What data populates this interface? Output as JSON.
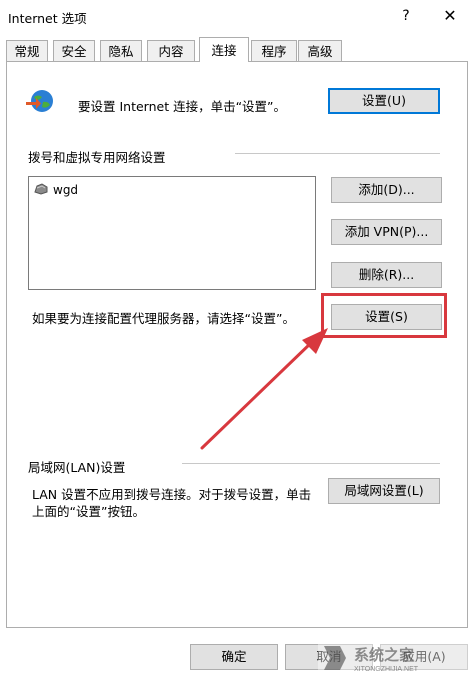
{
  "window": {
    "title": "Internet 选项",
    "help_label": "?",
    "close_label": "✕"
  },
  "tabs": [
    {
      "label": "常规"
    },
    {
      "label": "安全"
    },
    {
      "label": "隐私"
    },
    {
      "label": "内容"
    },
    {
      "label": "连接",
      "active": true
    },
    {
      "label": "程序"
    },
    {
      "label": "高级"
    }
  ],
  "setup": {
    "text": "要设置 Internet 连接，单击“设置”。",
    "button": "设置(U)"
  },
  "dialup": {
    "section_title": "拨号和虚拟专用网络设置",
    "items": [
      {
        "name": "wgd"
      }
    ],
    "add_button": "添加(D)...",
    "add_vpn_button": "添加 VPN(P)...",
    "delete_button": "删除(R)...",
    "proxy_text": "如果要为连接配置代理服务器，请选择“设置”。",
    "settings_button": "设置(S)"
  },
  "lan": {
    "section_title": "局域网(LAN)设置",
    "text_line1": "LAN 设置不应用到拨号连接。对于拨号设置，单击",
    "text_line2": "上面的“设置”按钮。",
    "button": "局域网设置(L)"
  },
  "footer": {
    "ok": "确定",
    "cancel": "取消",
    "apply": "应用(A)"
  },
  "colors": {
    "annotation_red": "#d8383e",
    "focus_blue": "#0078d7"
  },
  "watermark": {
    "text": "系统之家",
    "subtext": "XITONGZHIJIA.NET"
  }
}
